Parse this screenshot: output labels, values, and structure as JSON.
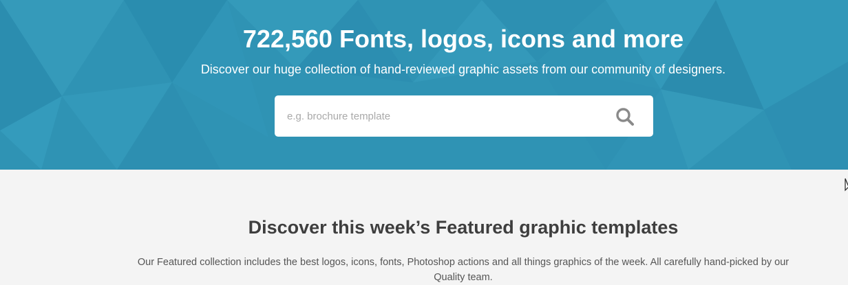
{
  "hero": {
    "title": "722,560 Fonts, logos, icons and more",
    "subtitle": "Discover our huge collection of hand-reviewed graphic assets from our community of designers.",
    "search": {
      "placeholder": "e.g. brochure template",
      "icon": "search-icon"
    }
  },
  "featured": {
    "title": "Discover this week’s Featured graphic templates",
    "description": "Our Featured collection includes the best logos, icons, fonts, Photoshop actions and all things graphics of the week. All carefully hand-picked by our Quality team."
  },
  "colors": {
    "hero_background": "#2f93b4",
    "page_background": "#f4f4f4",
    "heading_text": "#3e3e3e",
    "body_text": "#555555",
    "search_icon": "#8a8a8a"
  }
}
